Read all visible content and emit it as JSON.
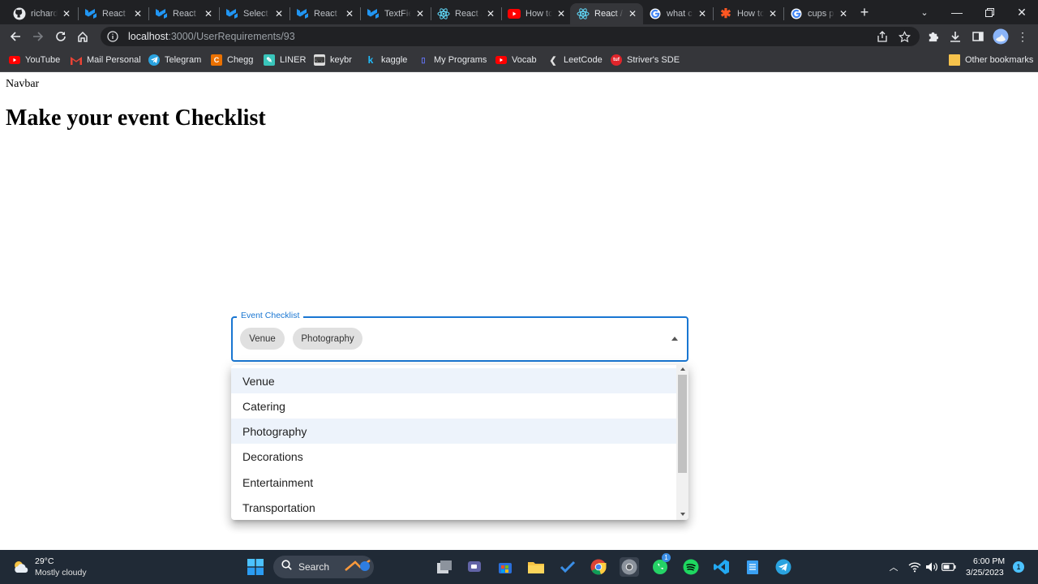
{
  "browser": {
    "tabs": [
      {
        "title": "richard",
        "icon": "github-icon",
        "active": false
      },
      {
        "title": "React S",
        "icon": "mui-icon",
        "active": false
      },
      {
        "title": "React S",
        "icon": "mui-icon",
        "active": false
      },
      {
        "title": "Select",
        "icon": "mui-icon",
        "active": false
      },
      {
        "title": "React S",
        "icon": "mui-icon",
        "active": false
      },
      {
        "title": "TextFie",
        "icon": "mui-icon",
        "active": false
      },
      {
        "title": "React /",
        "icon": "react-icon",
        "active": false
      },
      {
        "title": "How to",
        "icon": "youtube-icon",
        "active": false
      },
      {
        "title": "React /",
        "icon": "react-icon",
        "active": true
      },
      {
        "title": "what c",
        "icon": "google-icon",
        "active": false
      },
      {
        "title": "How to",
        "icon": "asterisk-icon",
        "active": false
      },
      {
        "title": "cups p",
        "icon": "google-icon",
        "active": false
      }
    ],
    "url_host": "localhost",
    "url_path": ":3000/UserRequirements/93",
    "bookmarks": [
      {
        "label": "YouTube",
        "icon": "youtube-icon",
        "color": "#ff0000"
      },
      {
        "label": "Mail Personal",
        "icon": "gmail-icon",
        "color": "#ea4335"
      },
      {
        "label": "Telegram",
        "icon": "telegram-icon",
        "color": "#2aa3e0"
      },
      {
        "label": "Chegg",
        "icon": "chegg-icon",
        "color": "#eb7100"
      },
      {
        "label": "LINER",
        "icon": "liner-icon",
        "color": "#39c5bb"
      },
      {
        "label": "keybr",
        "icon": "keybr-icon",
        "color": "#dddddd"
      },
      {
        "label": "kaggle",
        "icon": "kaggle-icon",
        "color": "#20beff"
      },
      {
        "label": "My Programs",
        "icon": "programs-icon",
        "color": "#5566ee"
      },
      {
        "label": "Vocab",
        "icon": "youtube-icon",
        "color": "#ff0000"
      },
      {
        "label": "LeetCode",
        "icon": "leetcode-icon",
        "color": "#e0e0e0"
      },
      {
        "label": "Striver's SDE",
        "icon": "striver-icon",
        "color": "#e0252b"
      }
    ],
    "other_bookmarks": "Other bookmarks"
  },
  "page": {
    "navbar": "Navbar",
    "title": "Make your event Checklist",
    "select_label": "Event Checklist",
    "chips": [
      "Venue",
      "Photography"
    ],
    "options": [
      {
        "label": "Venue",
        "selected": true
      },
      {
        "label": "Catering",
        "selected": false
      },
      {
        "label": "Photography",
        "selected": true
      },
      {
        "label": "Decorations",
        "selected": false
      },
      {
        "label": "Entertainment",
        "selected": false
      },
      {
        "label": "Transportation",
        "selected": false
      }
    ],
    "accent": "#1976d2",
    "selected_bg": "#edf3fb"
  },
  "taskbar": {
    "weather_temp": "29°C",
    "weather_desc": "Mostly cloudy",
    "search_label": "Search",
    "time": "6:00 PM",
    "date": "3/25/2023",
    "notification_count": "1",
    "whatsapp_badge": "1"
  }
}
